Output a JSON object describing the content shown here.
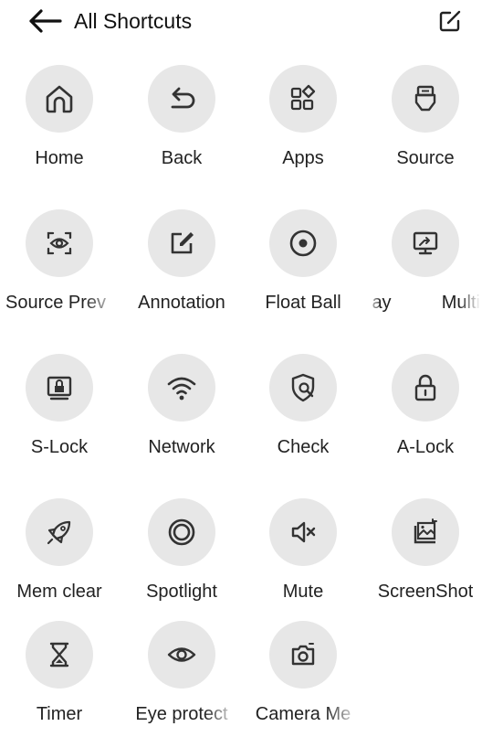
{
  "header": {
    "title": "All Shortcuts"
  },
  "shortcuts": {
    "home": "Home",
    "back": "Back",
    "apps": "Apps",
    "source": "Source",
    "source_preview": "Source Prev",
    "annotation": "Annotation",
    "float_ball": "Float Ball",
    "float_ball_overflow": "ay",
    "multi": "Multi",
    "s_lock": "S-Lock",
    "network": "Network",
    "check": "Check",
    "a_lock": "A-Lock",
    "mem_clear": "Mem clear",
    "spotlight": "Spotlight",
    "mute": "Mute",
    "screenshot": "ScreenShot",
    "timer": "Timer",
    "eye_protect": "Eye protect",
    "camera_me": "Camera Me"
  },
  "colors": {
    "icon_circle": "#e7e7e7",
    "icon_stroke": "#333333",
    "text": "#222222"
  }
}
